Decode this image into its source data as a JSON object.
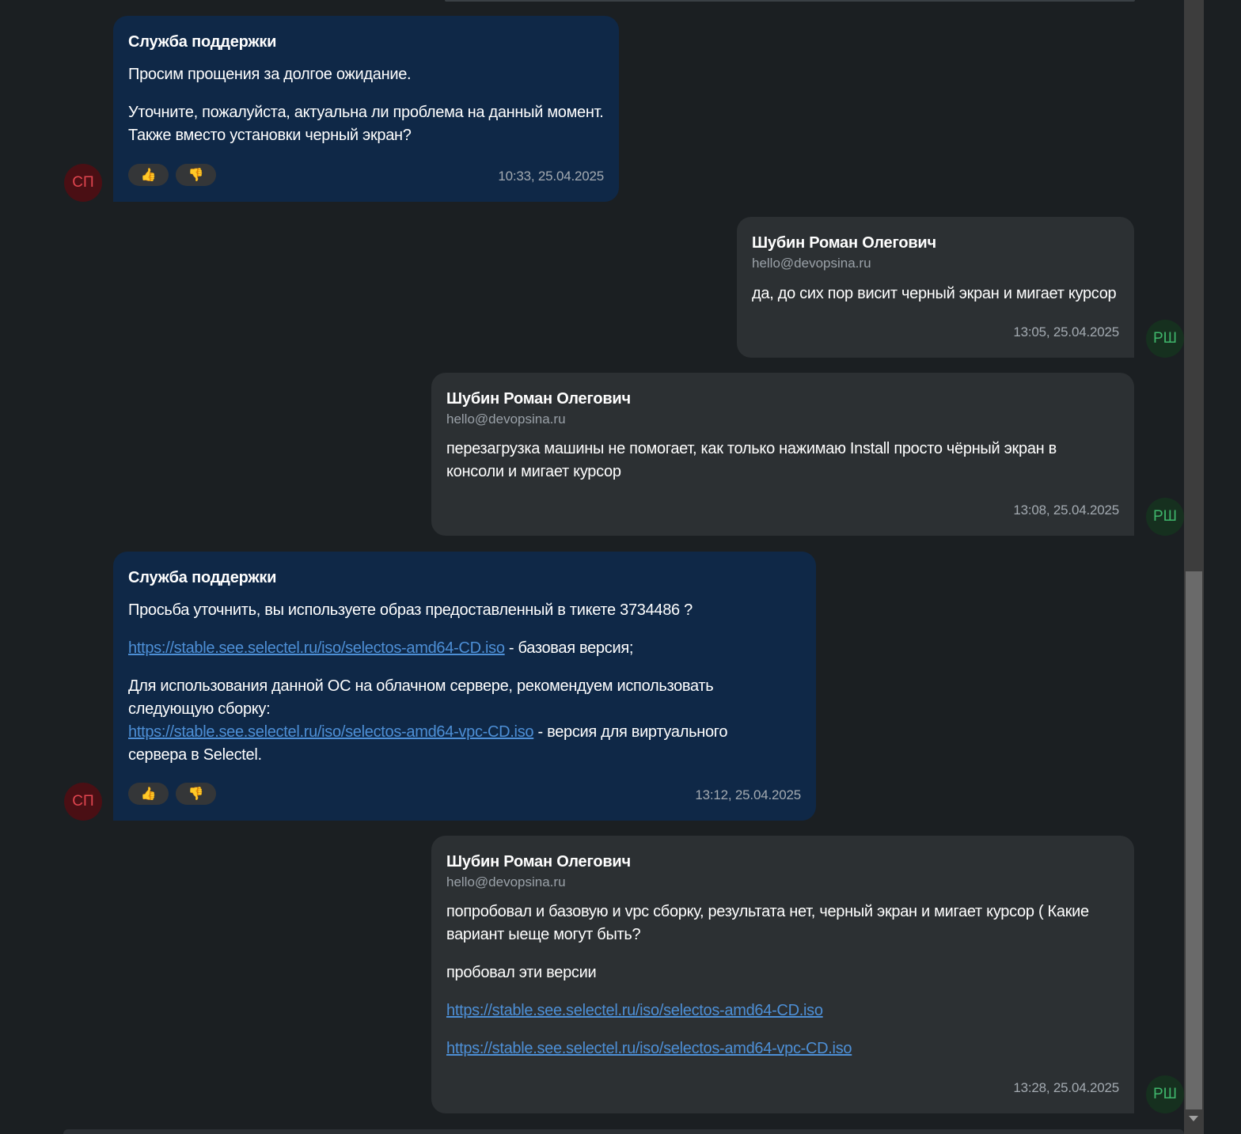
{
  "messages": [
    {
      "sender": "Служба поддержки",
      "avatar": "СП",
      "paragraphs": [
        "Просим прощения за долгое ожидание.",
        "Уточните, пожалуйста, актуальна ли проблема на данный момент.",
        "Также вместо установки черный экран?"
      ],
      "time": "10:33, 25.04.2025",
      "reactions": [
        "👍",
        "👎"
      ]
    },
    {
      "sender": "Шубин Роман Олегович",
      "email": "hello@devopsina.ru",
      "avatar": "РШ",
      "paragraphs": [
        "да, до сих пор висит черный экран и мигает курсор"
      ],
      "time": "13:05, 25.04.2025"
    },
    {
      "sender": "Шубин Роман Олегович",
      "email": "hello@devopsina.ru",
      "avatar": "РШ",
      "paragraphs": [
        "перезагрузка машины не помогает, как только нажимаю Install просто чёрный экран в консоли и мигает курсор"
      ],
      "time": "13:08, 25.04.2025"
    },
    {
      "sender": "Служба поддержки",
      "avatar": "СП",
      "p1": "Просьба уточнить, вы используете образ предоставленный в тикете 3734486 ?",
      "link1": "https://stable.see.selectel.ru/iso/selectos-amd64-CD.iso",
      "link1_suffix": " - базовая версия;",
      "p3": "Для использования данной ОС на облачном сервере, рекомендуем использовать следующую сборку:",
      "link2": "https://stable.see.selectel.ru/iso/selectos-amd64-vpc-CD.iso",
      "link2_suffix": " - версия для виртуального сервера в Selectel.",
      "time": "13:12, 25.04.2025",
      "reactions": [
        "👍",
        "👎"
      ]
    },
    {
      "sender": "Шубин Роман Олегович",
      "email": "hello@devopsina.ru",
      "avatar": "РШ",
      "p1": "попробовал и базовую и vpc сборку, результата нет, черный экран и мигает курсор ( Какие вариант ыеще могут быть?",
      "p2": "пробовал эти версии",
      "link1": "https://stable.see.selectel.ru/iso/selectos-amd64-CD.iso",
      "link2": "https://stable.see.selectel.ru/iso/selectos-amd64-vpc-CD.iso",
      "time": "13:28, 25.04.2025"
    }
  ],
  "colors": {
    "page_bg": "#1b1f22",
    "support_bubble": "#0f2847",
    "user_bubble": "#2c3033",
    "link": "#4d8fd6",
    "support_avatar_bg": "#4a0f14",
    "support_avatar_text": "#e0454f",
    "user_avatar_bg": "#16301f",
    "user_avatar_text": "#3fb56b"
  }
}
